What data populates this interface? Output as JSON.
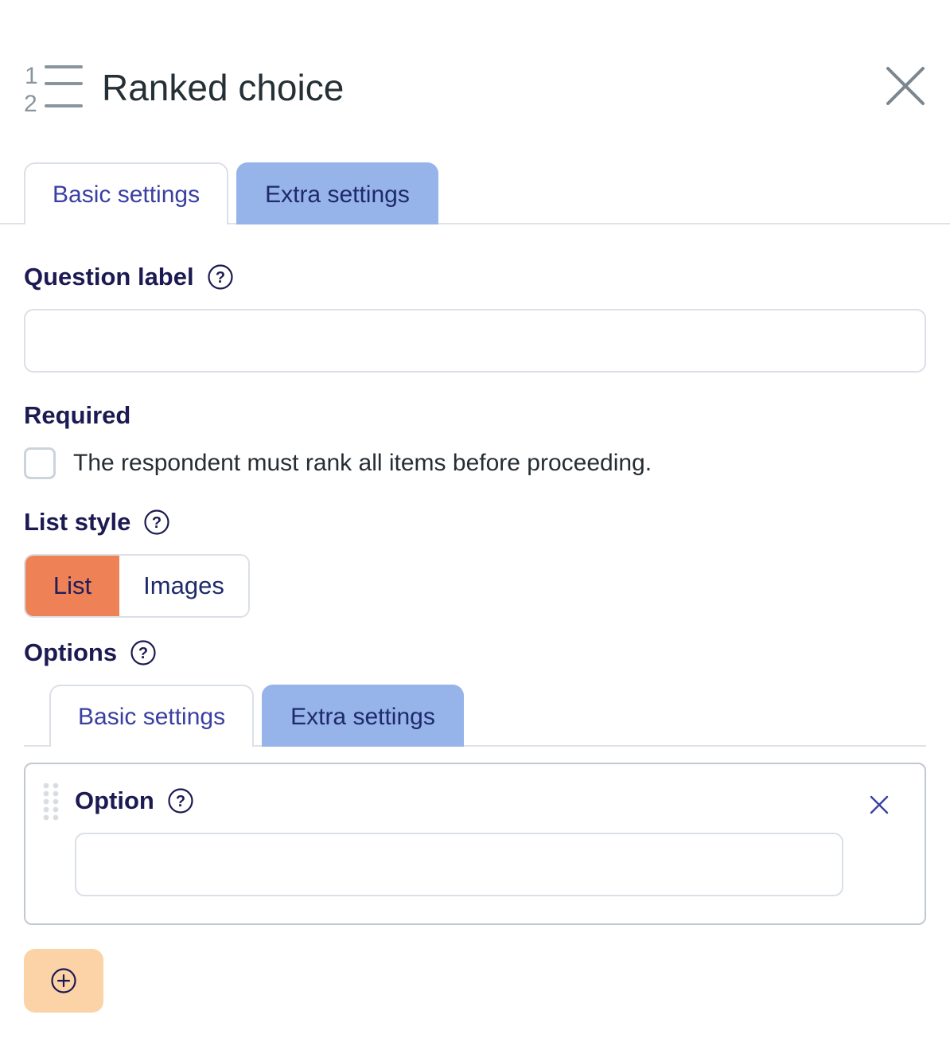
{
  "header": {
    "title": "Ranked choice",
    "icon": "numbered-list-icon",
    "close_icon": "close-icon"
  },
  "tabs": [
    {
      "label": "Basic settings",
      "active": false
    },
    {
      "label": "Extra settings",
      "active": true
    }
  ],
  "question_label": {
    "label": "Question label",
    "value": "",
    "placeholder": ""
  },
  "required": {
    "label": "Required",
    "checkbox_text": "The respondent must rank all items before proceeding.",
    "checked": false
  },
  "list_style": {
    "label": "List style",
    "options": [
      {
        "label": "List",
        "selected": true
      },
      {
        "label": "Images",
        "selected": false
      }
    ]
  },
  "options": {
    "label": "Options",
    "tabs": [
      {
        "label": "Basic settings",
        "active": false
      },
      {
        "label": "Extra settings",
        "active": true
      }
    ],
    "items": [
      {
        "label": "Option",
        "value": "",
        "placeholder": ""
      }
    ],
    "add_icon": "plus-circle-icon"
  },
  "colors": {
    "active_tab": "#96b3ea",
    "selected_segment": "#ef8157",
    "add_button": "#fcd2a7",
    "label_text": "#1b1a52"
  }
}
